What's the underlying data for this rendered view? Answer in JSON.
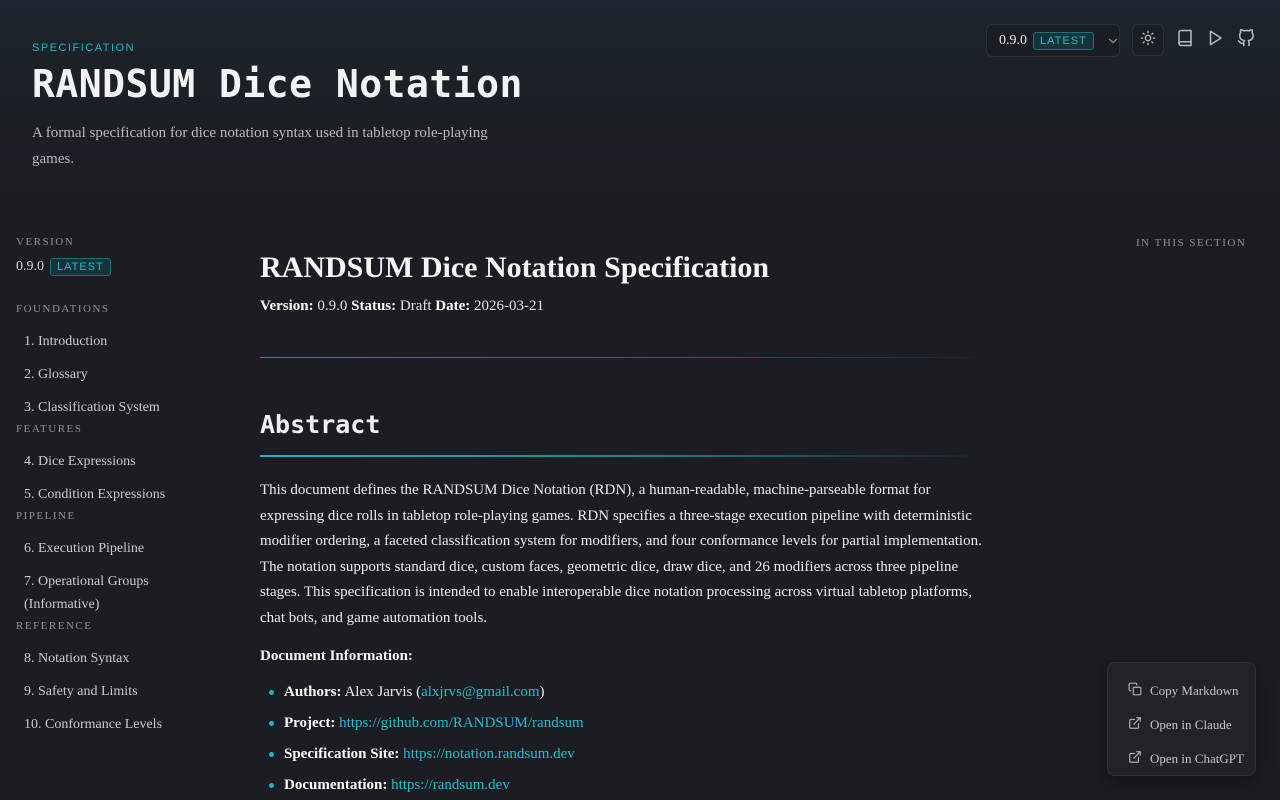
{
  "hero": {
    "eyebrow": "SPECIFICATION",
    "title": "RANDSUM Dice Notation",
    "subtitle": "A formal specification for dice notation syntax used in tabletop role-playing games."
  },
  "topbar": {
    "version": "0.9.0",
    "badge": "LATEST",
    "icons": [
      "chevron-down-icon",
      "sun-icon",
      "book-icon",
      "play-icon",
      "github-icon"
    ]
  },
  "sidebar": {
    "version_heading": "VERSION",
    "version": "0.9.0",
    "badge": "LATEST",
    "groups": [
      {
        "heading": "FOUNDATIONS",
        "items": [
          "1. Introduction",
          "2. Glossary",
          "3. Classification System"
        ]
      },
      {
        "heading": "FEATURES",
        "items": [
          "4. Dice Expressions",
          "5. Condition Expressions"
        ]
      },
      {
        "heading": "PIPELINE",
        "items": [
          "6. Execution Pipeline",
          "7. Operational Groups (Informative)"
        ]
      },
      {
        "heading": "REFERENCE",
        "items": [
          "8. Notation Syntax",
          "9. Safety and Limits",
          "10. Conformance Levels"
        ]
      }
    ]
  },
  "main": {
    "title": "RANDSUM Dice Notation Specification",
    "meta": {
      "version_label": "Version:",
      "version": "0.9.0",
      "status_label": "Status:",
      "status": "Draft",
      "date_label": "Date:",
      "date": "2026-03-21"
    },
    "section_title": "Abstract",
    "abstract": "This document defines the RANDSUM Dice Notation (RDN), a human-readable, machine-parseable format for expressing dice rolls in tabletop role-playing games. RDN specifies a three-stage execution pipeline with deterministic modifier ordering, a faceted classification system for modifiers, and four conformance levels for partial implementation. The notation supports standard dice, custom faces, geometric dice, draw dice, and 26 modifiers across three pipeline stages. This specification is intended to enable interoperable dice notation processing across virtual tabletop platforms, chat bots, and game automation tools.",
    "doc_info_heading": "Document Information:",
    "info": [
      {
        "label": "Authors:",
        "text": "Alex Jarvis (",
        "link": "alxjrvs@gmail.com",
        "after": ")"
      },
      {
        "label": "Project:",
        "text": "",
        "link": "https://github.com/RANDSUM/randsum",
        "after": ""
      },
      {
        "label": "Specification Site:",
        "text": "",
        "link": "https://notation.randsum.dev",
        "after": ""
      },
      {
        "label": "Documentation:",
        "text": "",
        "link": "https://randsum.dev",
        "after": ""
      }
    ]
  },
  "toc": {
    "heading": "IN THIS SECTION"
  },
  "float_menu": {
    "items": [
      {
        "label": "Copy Markdown",
        "icon": "copy-icon"
      },
      {
        "label": "Open in Claude",
        "icon": "external-link-icon"
      },
      {
        "label": "Open in ChatGPT",
        "icon": "external-link-icon"
      }
    ]
  },
  "colors": {
    "accent": "#22b3c9",
    "background": "#1b1d22",
    "text": "#e6e6e6"
  }
}
